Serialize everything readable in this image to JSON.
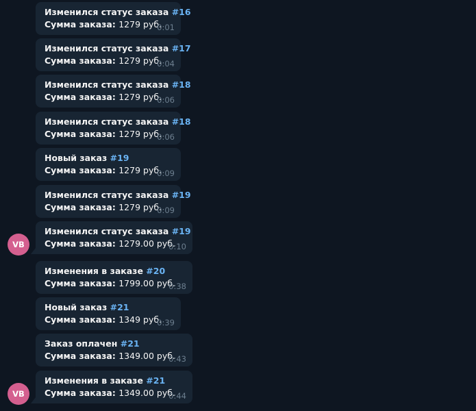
{
  "messages": [
    {
      "title": "Изменился статус заказа",
      "order": "#16",
      "sum_label": "Сумма заказа:",
      "sum_value": "1279 руб.",
      "time": "0:01"
    },
    {
      "title": "Изменился статус заказа",
      "order": "#17",
      "sum_label": "Сумма заказа:",
      "sum_value": "1279 руб.",
      "time": "0:04"
    },
    {
      "title": "Изменился статус заказа",
      "order": "#18",
      "sum_label": "Сумма заказа:",
      "sum_value": "1279 руб.",
      "time": "0:06"
    },
    {
      "title": "Изменился статус заказа",
      "order": "#18",
      "sum_label": "Сумма заказа:",
      "sum_value": "1279 руб.",
      "time": "0:06"
    },
    {
      "title": "Новый заказ",
      "order": "#19",
      "sum_label": "Сумма заказа:",
      "sum_value": "1279 руб.",
      "time": "0:09"
    },
    {
      "title": "Изменился статус заказа",
      "order": "#19",
      "sum_label": "Сумма заказа:",
      "sum_value": "1279 руб.",
      "time": "0:09"
    },
    {
      "title": "Изменился статус заказа",
      "order": "#19",
      "sum_label": "Сумма заказа:",
      "sum_value": "1279.00 руб.",
      "time": "0:10"
    },
    {
      "title": "Изменения в заказе",
      "order": "#20",
      "sum_label": "Сумма заказа:",
      "sum_value": "1799.00 руб.",
      "time": "0:38"
    },
    {
      "title": "Новый заказ",
      "order": "#21",
      "sum_label": "Сумма заказа:",
      "sum_value": "1349 руб.",
      "time": "0:39"
    },
    {
      "title": "Заказ оплачен",
      "order": "#21",
      "sum_label": "Сумма заказа:",
      "sum_value": "1349.00 руб.",
      "time": "0:43"
    },
    {
      "title": "Изменения в заказе",
      "order": "#21",
      "sum_label": "Сумма заказа:",
      "sum_value": "1349.00 руб.",
      "time": "0:44"
    }
  ],
  "avatars": [
    {
      "initials": "VB",
      "color": "#d45f8f"
    },
    {
      "initials": "VB",
      "color": "#d45f8f"
    }
  ],
  "colors": {
    "background": "#0e1621",
    "bubble": "#182533",
    "link": "#6ab3f3",
    "timestamp": "#6d7f8f",
    "text": "#f5f5f5"
  }
}
